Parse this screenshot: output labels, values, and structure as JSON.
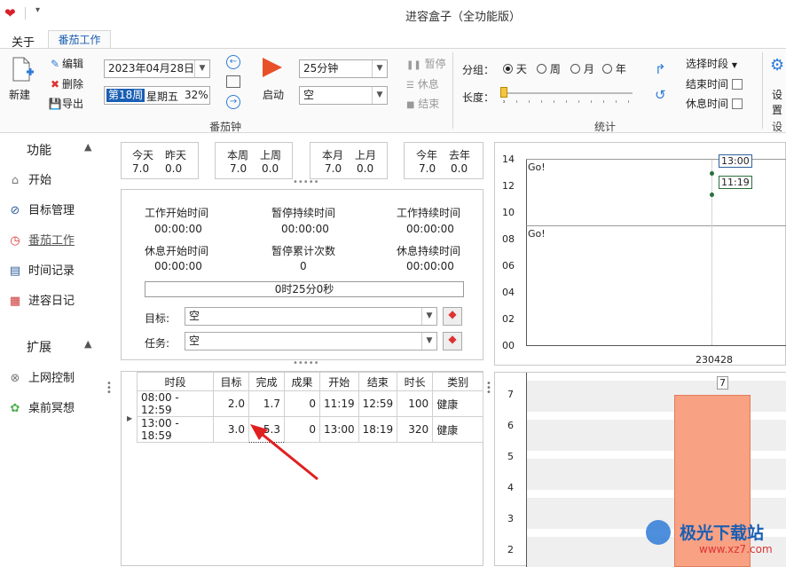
{
  "window": {
    "title": "进容盒子（全功能版）"
  },
  "tabs": [
    {
      "label": "关于"
    },
    {
      "label": "番茄工作"
    }
  ],
  "ribbon": {
    "new_label": "新建",
    "edit_label": "编辑",
    "delete_label": "删除",
    "export_label": "导出",
    "date_value": "2023年04月28日",
    "week_label": "第18周",
    "weekday_label": "星期五",
    "percent_label": "32%",
    "start_label": "启动",
    "duration_value": "25分钟",
    "task_value": "空",
    "pause_label": "暂停",
    "rest_label": "休息",
    "end_label": "结束",
    "group_title": "番茄钟",
    "grouping_label": "分组：",
    "grouping_options": [
      "天",
      "周",
      "月",
      "年"
    ],
    "grouping_selected": "天",
    "length_label": "长度：",
    "stats_group_title": "统计",
    "select_period_label": "选择时段",
    "end_time_label": "结束时间",
    "rest_time_label": "休息时间",
    "settings_label": "设置",
    "settings_group_title": "设"
  },
  "sidebar": {
    "section1": "功能",
    "items": [
      {
        "label": "开始",
        "icon": "home-icon"
      },
      {
        "label": "目标管理",
        "icon": "compass-icon"
      },
      {
        "label": "番茄工作",
        "icon": "clock-icon"
      },
      {
        "label": "时间记录",
        "icon": "log-icon"
      },
      {
        "label": "进容日记",
        "icon": "calendar-icon"
      }
    ],
    "section2": "扩展",
    "items2": [
      {
        "label": "上网控制",
        "icon": "eye-off-icon"
      },
      {
        "label": "桌前冥想",
        "icon": "lotus-icon"
      }
    ]
  },
  "stats": [
    {
      "l1": "今天",
      "l2": "昨天",
      "v1": "7.0",
      "v2": "0.0"
    },
    {
      "l1": "本周",
      "l2": "上周",
      "v1": "7.0",
      "v2": "0.0"
    },
    {
      "l1": "本月",
      "l2": "上月",
      "v1": "7.0",
      "v2": "0.0"
    },
    {
      "l1": "今年",
      "l2": "去年",
      "v1": "7.0",
      "v2": "0.0"
    }
  ],
  "timer": {
    "work_start_label": "工作开始时间",
    "work_start_value": "00:00:00",
    "pause_dur_label": "暂停持续时间",
    "pause_dur_value": "00:00:00",
    "work_dur_label": "工作持续时间",
    "work_dur_value": "00:00:00",
    "rest_start_label": "休息开始时间",
    "rest_start_value": "00:00:00",
    "pause_count_label": "暂停累计次数",
    "pause_count_value": "0",
    "rest_dur_label": "休息持续时间",
    "rest_dur_value": "00:00:00",
    "progress_text": "0时25分0秒",
    "goal_label": "目标:",
    "goal_value": "空",
    "task_label": "任务:",
    "task_value": "空"
  },
  "table": {
    "headers": [
      "时段",
      "目标",
      "完成",
      "成果",
      "开始",
      "结束",
      "时长",
      "类别"
    ],
    "rows": [
      [
        "08:00 - 12:59",
        "2.0",
        "1.7",
        "0",
        "11:19",
        "12:59",
        "100",
        "健康"
      ],
      [
        "13:00 - 18:59",
        "3.0",
        "5.3",
        "0",
        "13:00",
        "18:19",
        "320",
        "健康"
      ]
    ]
  },
  "chart_data": [
    {
      "type": "line",
      "y_ticks": [
        "14",
        "12",
        "10",
        "08",
        "06",
        "04",
        "02",
        "00"
      ],
      "x_ticks": [
        "230428"
      ],
      "panel_labels": [
        "Go!",
        "Go!"
      ],
      "annotations": [
        "13:00",
        "11:19"
      ]
    },
    {
      "type": "bar",
      "y_ticks": [
        "7",
        "6",
        "5",
        "4",
        "3",
        "2"
      ],
      "values": [
        7
      ],
      "data_labels": [
        "7"
      ],
      "color": "#f8a183"
    }
  ],
  "watermark": {
    "text": "极光下载站",
    "url": "www.xz7.com"
  }
}
